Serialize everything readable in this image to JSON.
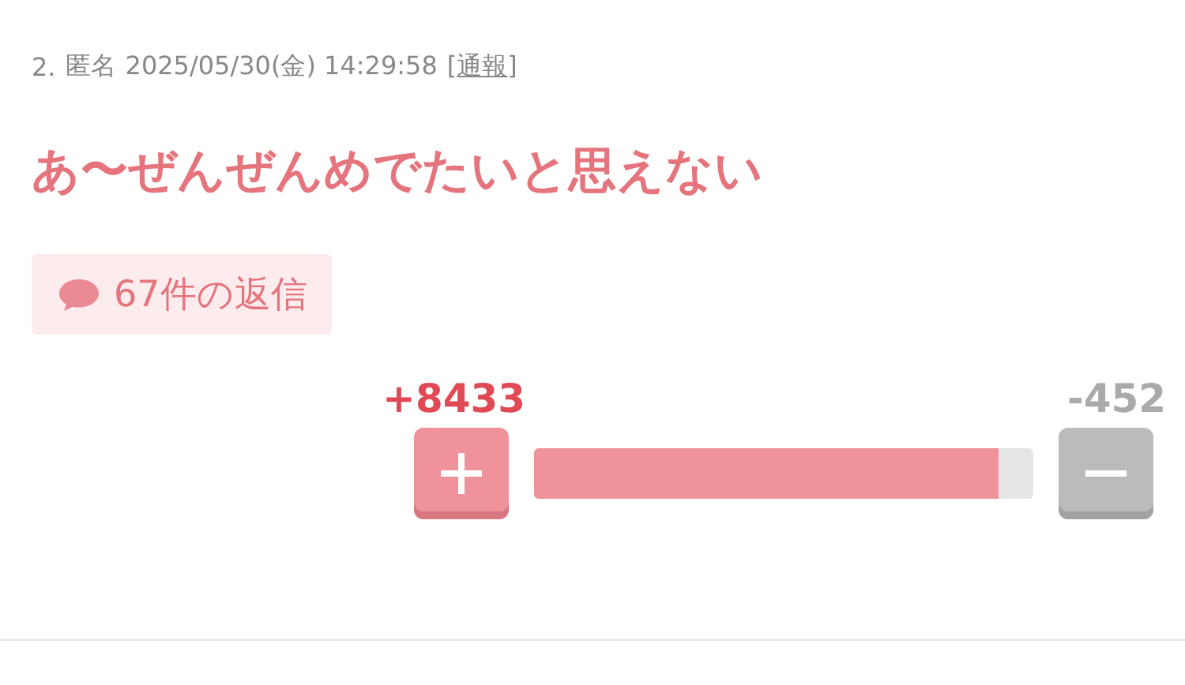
{
  "meta": {
    "number": "2.",
    "author": "匿名",
    "date": "2025/05/30(金) 14:29:58",
    "report_open": "[",
    "report_link": "通報",
    "report_close": "]"
  },
  "title": "あ〜ぜんぜんめでたいと思えない",
  "replies": {
    "label": "67件の返信"
  },
  "vote": {
    "plus_count": "+8433",
    "minus_count": "-452",
    "level": 0.93
  }
}
